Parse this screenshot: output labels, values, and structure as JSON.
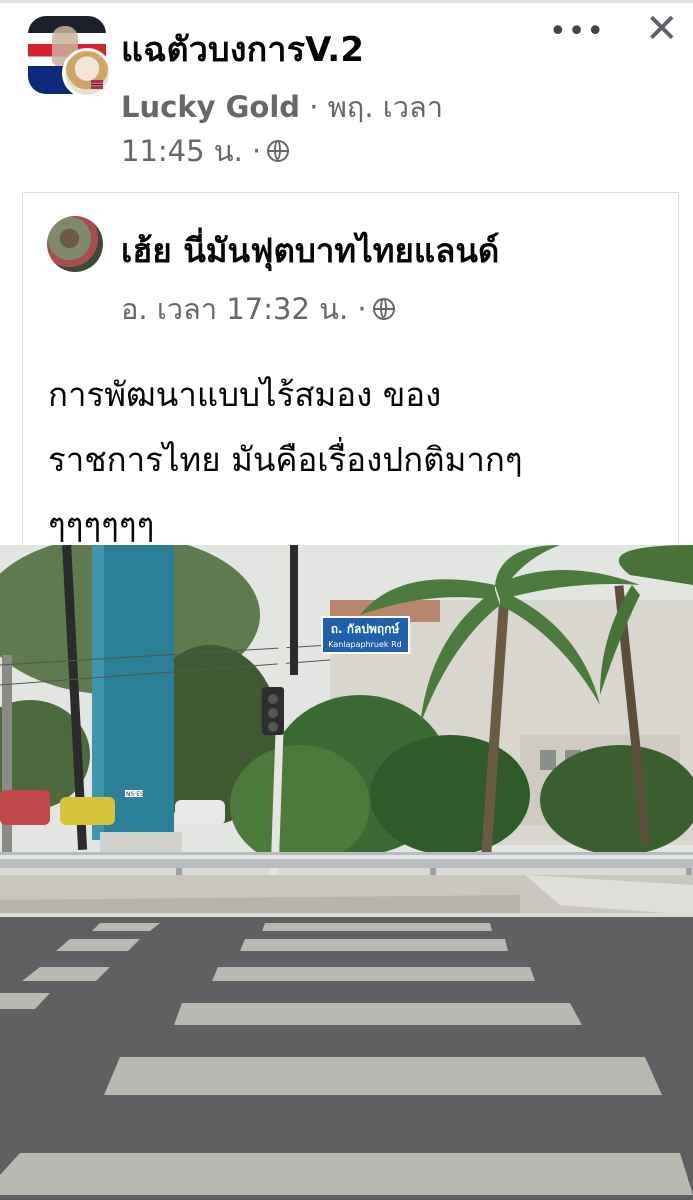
{
  "header": {
    "group_name": "แฉตัวบงการV.2",
    "author": "Lucky Gold",
    "meta_separator": " · ",
    "date": "พฤ. เวลา",
    "time": "11:45 น. ·",
    "more_icon": "more-dots-icon",
    "close_icon": "close-icon",
    "privacy_icon": "globe-icon"
  },
  "shared_post": {
    "page_name": "เฮ้ย นี่มันฟุตบาทไทยแลนด์",
    "meta": "อ. เวลา 17:32 น. ·",
    "text_lines": [
      "การพัฒนาแบบไร้สมอง ของ",
      "ราชการไทย มันคือเรื่องปกติมากๆ",
      "ๆๆๆๆๆๆ"
    ],
    "photo": {
      "street_sign_thai": "ถ. กัลปพฤกษ์",
      "street_sign_en": "Kanlapaphruek Rd",
      "pillar_tag": "NS·ES"
    }
  },
  "colors": {
    "primary_text": "#050505",
    "secondary_text": "#65676b",
    "card_border": "#dadde1",
    "sign_blue": "#1f5fae"
  }
}
